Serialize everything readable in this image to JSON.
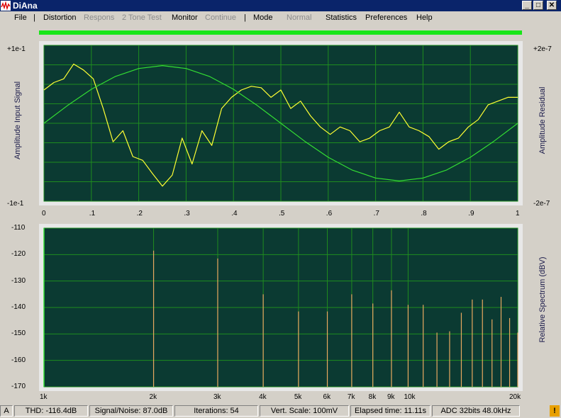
{
  "window": {
    "title": "DiAna",
    "controls": [
      "_",
      "□",
      "✕"
    ]
  },
  "menu": [
    {
      "label": "File",
      "enabled": true
    },
    {
      "sep": true
    },
    {
      "label": "Distortion",
      "enabled": true
    },
    {
      "label": "Respons",
      "enabled": false
    },
    {
      "label": "2 Tone Test",
      "enabled": false
    },
    {
      "label": "Monitor",
      "enabled": true
    },
    {
      "label": "Continue",
      "enabled": false
    },
    {
      "sep": true
    },
    {
      "label": "Mode",
      "enabled": true
    },
    {
      "label": "Normal",
      "enabled": false
    },
    {
      "label": "Statistics",
      "enabled": true
    },
    {
      "label": "Preferences",
      "enabled": true
    },
    {
      "label": "Help",
      "enabled": true
    }
  ],
  "progress": {
    "value": 1.0,
    "color": "#19e619"
  },
  "colors": {
    "plot_bg": "#0b3a32",
    "grid": "#1f8c1f",
    "signal": "#ffff33",
    "residual": "#33dd33",
    "spectrum_line": "#e8a860"
  },
  "chart_data": [
    {
      "type": "line",
      "name": "time-domain",
      "x": [
        0,
        0.1,
        0.2,
        0.3,
        0.4,
        0.5,
        0.6,
        0.7,
        0.8,
        0.9,
        1
      ],
      "x_tick_labels": [
        "0",
        ".1",
        ".2",
        ".3",
        ".4",
        ".5",
        ".6",
        ".7",
        ".8",
        ".9",
        "1"
      ],
      "xlim": [
        0,
        1
      ],
      "y_left_label": "Amplitude Input Signal",
      "y_left_top": "+1e-1",
      "y_left_bottom": "-1e-1",
      "y_right_label": "Amplitude Residual",
      "y_right_top": "+2e-7",
      "y_right_bottom": "-2e-7",
      "grid": true,
      "series": [
        {
          "values": [
            0.45,
            0.55,
            0.6,
            0.8,
            0.72,
            0.6,
            0.2,
            -0.25,
            -0.1,
            -0.45,
            -0.5,
            -0.68,
            -0.85,
            -0.7,
            -0.2,
            -0.55,
            -0.1,
            -0.3,
            0.2,
            0.35,
            0.45,
            0.5,
            0.48,
            0.35,
            0.45,
            0.2,
            0.3,
            0.1,
            -0.05,
            -0.15,
            -0.05,
            -0.1,
            -0.25,
            -0.2,
            -0.1,
            -0.05,
            0.15,
            -0.05,
            -0.1,
            -0.18,
            -0.35,
            -0.25,
            -0.2,
            -0.05,
            0.05,
            0.25,
            0.3,
            0.35,
            0.35
          ]
        },
        {
          "values": [
            0,
            0.31,
            0.59,
            0.81,
            0.95,
            1,
            0.95,
            0.81,
            0.59,
            0.31,
            0,
            -0.31,
            -0.59,
            -0.81,
            -0.95,
            -1,
            -0.95,
            -0.81,
            -0.59,
            -0.31,
            0
          ]
        }
      ]
    },
    {
      "type": "bar",
      "name": "spectrum",
      "x_scale": "log",
      "xlim_hz": [
        1000,
        20000
      ],
      "x_tick_values": [
        1000,
        2000,
        3000,
        4000,
        5000,
        6000,
        7000,
        8000,
        9000,
        10000,
        20000
      ],
      "x_tick_labels": [
        "1k",
        "2k",
        "3k",
        "4k",
        "5k",
        "6k",
        "7k",
        "8k",
        "9k",
        "10k",
        "20k"
      ],
      "y_tick_labels": [
        "-110",
        "-120",
        "-130",
        "-140",
        "-150",
        "-160",
        "-170"
      ],
      "ylim": [
        -170,
        -110
      ],
      "y_right_label": "Relative Spectrum (dBV)",
      "grid": true,
      "harmonics": {
        "freq_hz": [
          2000,
          3000,
          4000,
          5000,
          6000,
          7000,
          8000,
          9000,
          10000,
          11000,
          12000,
          13000,
          14000,
          15000,
          16000,
          17000,
          18000,
          19000,
          20000
        ],
        "db": [
          -118.5,
          -121.5,
          -135,
          -141.5,
          -141.5,
          -135,
          -138.5,
          -133.5,
          -139,
          -139,
          -149.5,
          -149,
          -142,
          -137,
          -137,
          -144.5,
          -136,
          -144,
          -149.5
        ]
      }
    }
  ],
  "status": [
    {
      "label": "A",
      "width": 18
    },
    {
      "label": "THD: -116.4dB",
      "width": 104
    },
    {
      "label": "Signal/Noise:  87.0dB",
      "width": 118
    },
    {
      "label": "Iterations: 54",
      "width": 118
    },
    {
      "label": "Vert. Scale: 100mV",
      "width": 126
    },
    {
      "label": "Elapsed time: 11.11s",
      "width": 113
    },
    {
      "label": "ADC 32bits 48.0kHz",
      "width": 124
    }
  ],
  "status_warn": "!"
}
